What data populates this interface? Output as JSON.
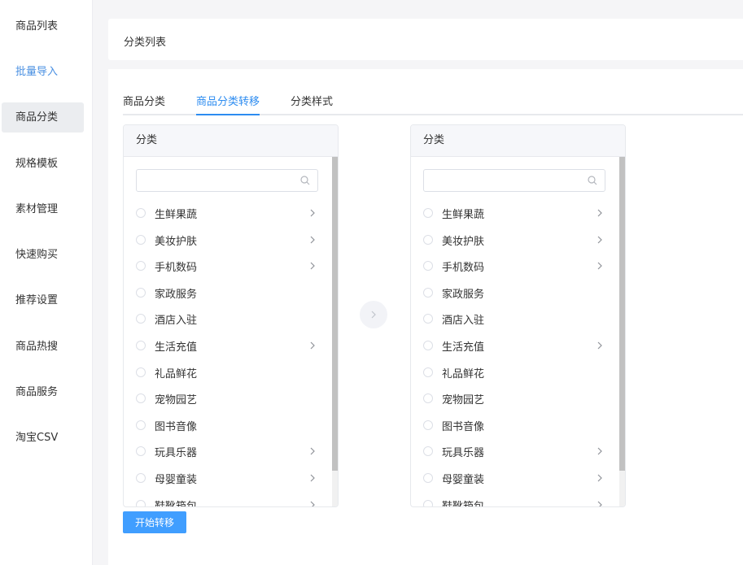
{
  "sidebar": {
    "items": [
      {
        "label": "商品列表"
      },
      {
        "label": "批量导入"
      },
      {
        "label": "商品分类"
      },
      {
        "label": "规格模板"
      },
      {
        "label": "素材管理"
      },
      {
        "label": "快速购买"
      },
      {
        "label": "推荐设置"
      },
      {
        "label": "商品热搜"
      },
      {
        "label": "商品服务"
      },
      {
        "label": "淘宝CSV"
      }
    ],
    "active_index": 2,
    "highlight_index": 1
  },
  "header": {
    "title": "分类列表"
  },
  "tabs": [
    {
      "label": "商品分类"
    },
    {
      "label": "商品分类转移"
    },
    {
      "label": "分类样式"
    }
  ],
  "active_tab": 1,
  "left_panel": {
    "title": "分类",
    "search": {
      "value": "",
      "placeholder": ""
    },
    "items": [
      {
        "label": "生鲜果蔬",
        "has_children": true
      },
      {
        "label": "美妆护肤",
        "has_children": true
      },
      {
        "label": "手机数码",
        "has_children": true
      },
      {
        "label": "家政服务",
        "has_children": false
      },
      {
        "label": "酒店入驻",
        "has_children": false
      },
      {
        "label": "生活充值",
        "has_children": true
      },
      {
        "label": "礼品鲜花",
        "has_children": false
      },
      {
        "label": "宠物园艺",
        "has_children": false
      },
      {
        "label": "图书音像",
        "has_children": false
      },
      {
        "label": "玩具乐器",
        "has_children": true
      },
      {
        "label": "母婴童装",
        "has_children": true
      },
      {
        "label": "鞋靴箱包",
        "has_children": true
      }
    ]
  },
  "right_panel": {
    "title": "分类",
    "search": {
      "value": "",
      "placeholder": ""
    },
    "items": [
      {
        "label": "生鲜果蔬",
        "has_children": true
      },
      {
        "label": "美妆护肤",
        "has_children": true
      },
      {
        "label": "手机数码",
        "has_children": true
      },
      {
        "label": "家政服务",
        "has_children": false
      },
      {
        "label": "酒店入驻",
        "has_children": false
      },
      {
        "label": "生活充值",
        "has_children": true
      },
      {
        "label": "礼品鲜花",
        "has_children": false
      },
      {
        "label": "宠物园艺",
        "has_children": false
      },
      {
        "label": "图书音像",
        "has_children": false
      },
      {
        "label": "玩具乐器",
        "has_children": true
      },
      {
        "label": "母婴童装",
        "has_children": true
      },
      {
        "label": "鞋靴箱包",
        "has_children": true
      }
    ]
  },
  "start_button": {
    "label": "开始转移"
  },
  "colors": {
    "accent": "#2d8cf0",
    "button": "#409eff",
    "sidebar_active_bg": "#ebedf0"
  }
}
